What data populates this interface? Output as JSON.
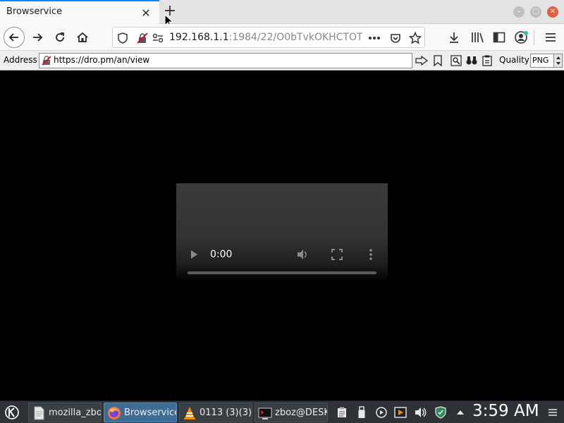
{
  "browser": {
    "tab_title": "Browservice",
    "tab_close": "✕",
    "new_tab": "+",
    "window_min": "–",
    "window_max": "□",
    "window_close": "✕"
  },
  "navbar": {
    "url_host": "192.168.1.1",
    "url_path": ":1984/22/O0bTvkOKHCTOT"
  },
  "addressbar": {
    "label": "Address",
    "url": "https://dro.pm/an/view",
    "quality_label": "Quality",
    "quality_value": "PNG"
  },
  "video": {
    "time": "0:00",
    "progress": 0
  },
  "taskbar": {
    "tasks": [
      {
        "label": "mozilla_zbo",
        "icon": "document-icon"
      },
      {
        "label": "Browservice",
        "icon": "firefox-icon",
        "active": true
      },
      {
        "label": "0113 (3)(3)",
        "icon": "vlc-icon"
      },
      {
        "label": "zboz@DESK",
        "icon": "terminal-icon"
      }
    ],
    "clock": "3:59 AM"
  },
  "colors": {
    "tab_accent": "#0a84ff",
    "window_close": "#e0603f",
    "taskbar_bg": "#2e3236",
    "active_task": "#3d6d94",
    "insecure_icon": "#d70022"
  }
}
